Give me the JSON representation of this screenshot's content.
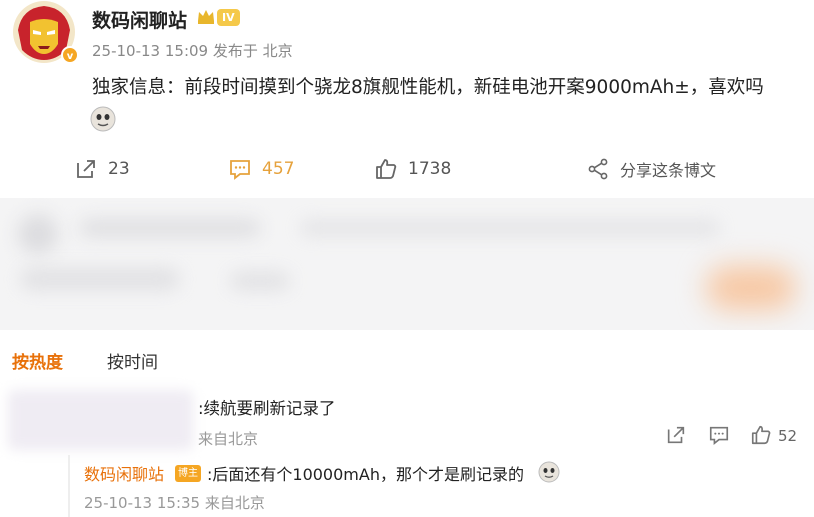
{
  "post": {
    "username": "数码闲聊站",
    "level_badge": "IV",
    "meta": "25-10-13 15:09 发布于 北京",
    "text": "独家信息：前段时间摸到个骁龙8旗舰性能机，新硅电池开案9000mAh±，喜欢吗",
    "avatar_icon": "iron-man-avatar-icon",
    "emoji_icon": "doge-emoji-icon"
  },
  "actions": {
    "repost_count": "23",
    "comment_count": "457",
    "like_count": "1738",
    "share_label": "分享这条博文"
  },
  "sort": {
    "hot": "按热度",
    "time": "按时间"
  },
  "comment": {
    "text": ":续航要刷新记录了",
    "location": "来自北京",
    "like_count": "52"
  },
  "reply": {
    "name": "数码闲聊站",
    "badge": "博主",
    "text": ":后面还有个10000mAh，那个才是刷记录的",
    "meta": "25-10-13 15:35 来自北京"
  },
  "colors": {
    "accent_orange": "#e8710a",
    "comment_gold": "#e6a23c",
    "level_gold": "#f5c94a",
    "muted_gray": "#888888"
  }
}
